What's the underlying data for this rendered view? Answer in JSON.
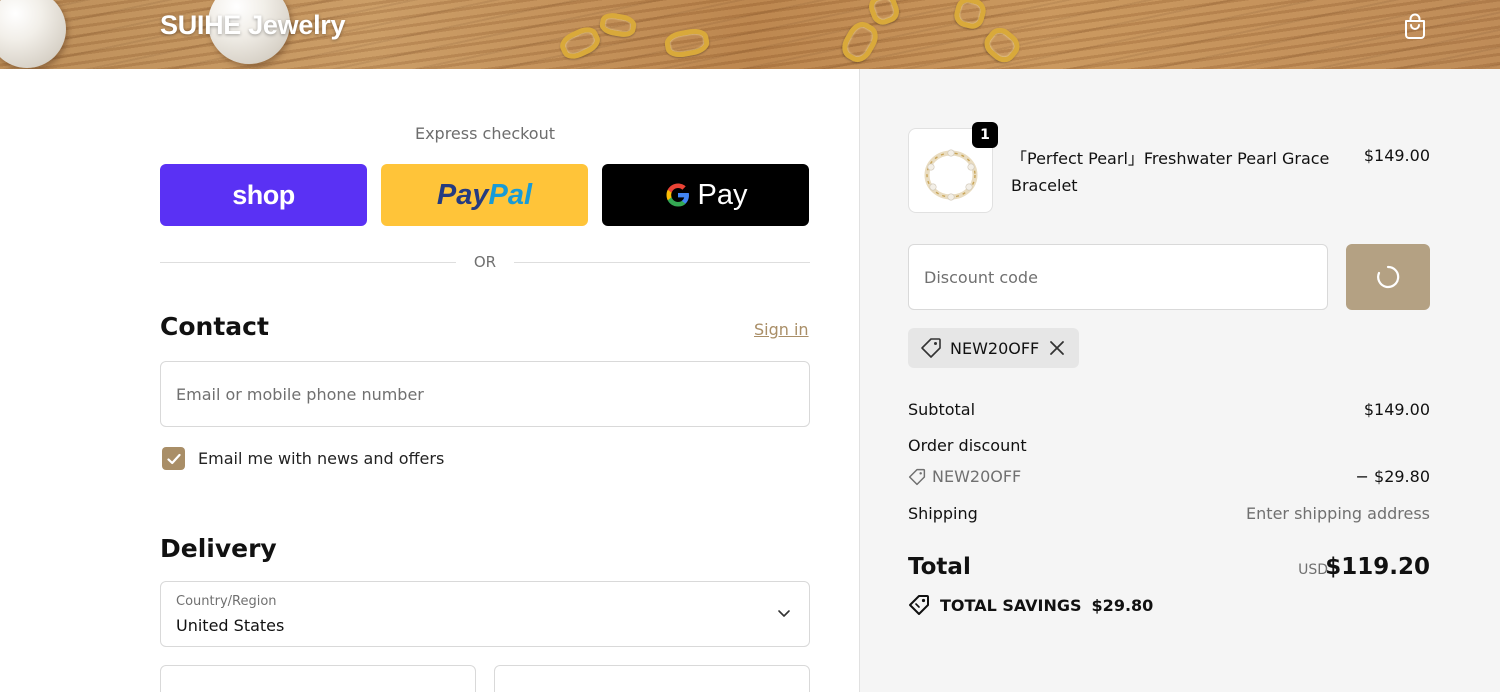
{
  "header": {
    "brand": "SUIHE Jewelry",
    "cart_icon": "shopping-bag-icon"
  },
  "express": {
    "label": "Express checkout",
    "shop_label": "shop",
    "paypal_label_1": "Pay",
    "paypal_label_2": "Pal",
    "gpay_g": "G",
    "gpay_label": "Pay",
    "or_label": "OR"
  },
  "contact": {
    "title": "Contact",
    "sign_in": "Sign in",
    "email_placeholder": "Email or mobile phone number",
    "email_value": "",
    "newsletter_label": "Email me with news and offers",
    "newsletter_checked": true
  },
  "delivery": {
    "title": "Delivery",
    "country_label": "Country/Region",
    "country_value": "United States"
  },
  "summary": {
    "product": {
      "quantity": "1",
      "name": "「Perfect Pearl」Freshwater Pearl Grace Bracelet",
      "price": "$149.00"
    },
    "discount_placeholder": "Discount code",
    "applied_code": "NEW20OFF",
    "rows": {
      "subtotal_label": "Subtotal",
      "subtotal_value": "$149.00",
      "order_discount_label": "Order discount",
      "discount_code": "NEW20OFF",
      "discount_value": "− $29.80",
      "shipping_label": "Shipping",
      "shipping_value": "Enter shipping address"
    },
    "total_label": "Total",
    "total_currency": "USD",
    "total_value": "$119.20",
    "savings_label": "TOTAL SAVINGS",
    "savings_value": "$29.80"
  },
  "colors": {
    "accent": "#a98e67",
    "shop_purple": "#5a31f4",
    "paypal_yellow": "#ffc439",
    "summary_bg": "#f5f5f5"
  }
}
